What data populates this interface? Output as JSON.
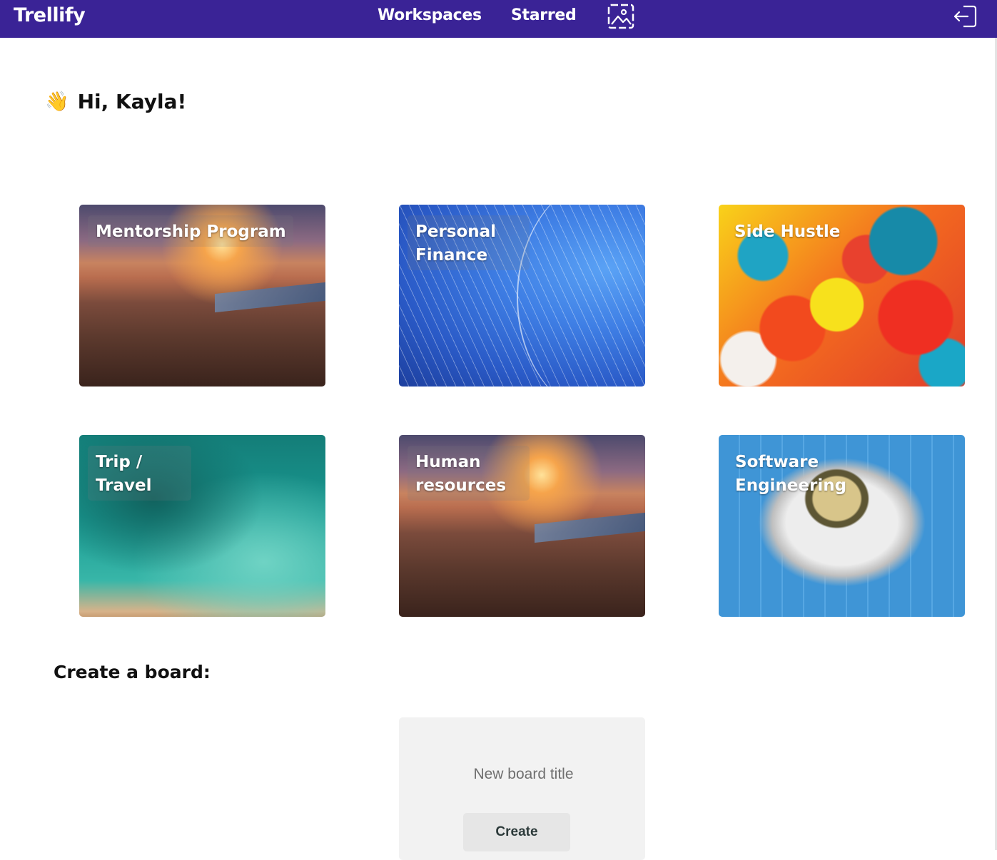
{
  "nav": {
    "brand": "Trellify",
    "workspaces_label": "Workspaces",
    "starred_label": "Starred",
    "gallery_icon": "image-gallery-icon",
    "logout_icon": "logout-icon",
    "bg_color": "#3a2396"
  },
  "greeting": {
    "emoji": "👋",
    "text": "Hi, Kayla!"
  },
  "boards": [
    {
      "title": "Mentorship Program",
      "background": "city skyline at sunset"
    },
    {
      "title": "Personal Finance",
      "background": "blue abstract lines"
    },
    {
      "title": "Side Hustle",
      "background": "colorful paint splatter"
    },
    {
      "title": "Trip / Travel",
      "background": "turquoise ocean aerial"
    },
    {
      "title": "Human resources",
      "background": "city skyline at sunset"
    },
    {
      "title": "Software Engineering",
      "background": "astronaut mural"
    }
  ],
  "create": {
    "heading": "Create a board:",
    "placeholder": "New board title",
    "button_label": "Create"
  }
}
